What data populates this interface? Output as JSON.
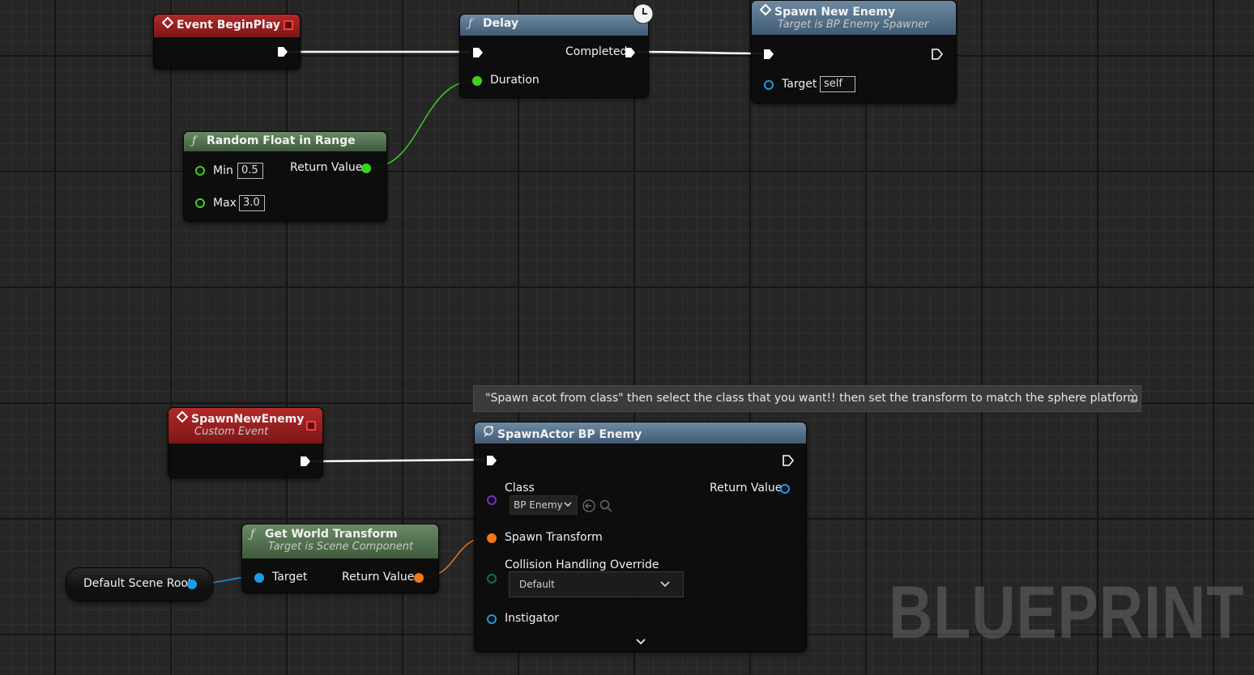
{
  "nodes": {
    "begin_play": {
      "title": "Event BeginPlay"
    },
    "delay": {
      "title": "Delay",
      "completed": "Completed",
      "duration": "Duration"
    },
    "spawn_new_enemy_call": {
      "title": "Spawn New Enemy",
      "subtitle": "Target is BP Enemy Spawner",
      "target_label": "Target",
      "target_value": "self"
    },
    "random_float": {
      "title": "Random Float in Range",
      "min_label": "Min",
      "min_value": "0.5",
      "max_label": "Max",
      "max_value": "3.0",
      "return_label": "Return Value"
    },
    "custom_event": {
      "title": "SpawnNewEnemy",
      "subtitle": "Custom Event"
    },
    "spawn_actor": {
      "title": "SpawnActor BP Enemy",
      "class_label": "Class",
      "class_value": "BP Enemy",
      "return_label": "Return Value",
      "spawn_transform": "Spawn Transform",
      "collision_label": "Collision Handling Override",
      "collision_value": "Default",
      "instigator": "Instigator"
    },
    "get_world_transform": {
      "title": "Get World Transform",
      "subtitle": "Target is Scene Component",
      "target_label": "Target",
      "return_label": "Return Value"
    },
    "default_scene_root": {
      "label": "Default Scene Root"
    }
  },
  "comment": {
    "text": "\"Spawn acot from class\" then select the class that you want!! then set the transform to match the sphere platform"
  },
  "watermark": "BLUEPRINT",
  "colors": {
    "exec": "#ffffff",
    "float_pin": "#3cd21e",
    "object_pin": "#1e9be6",
    "transform_pin": "#f07814",
    "class_pin": "#7a2cd6",
    "enum_pin": "#0a6e5a",
    "event_header": "#9b1f1f",
    "function_header": "#4f6a84",
    "pure_header": "#4f6e4c"
  }
}
